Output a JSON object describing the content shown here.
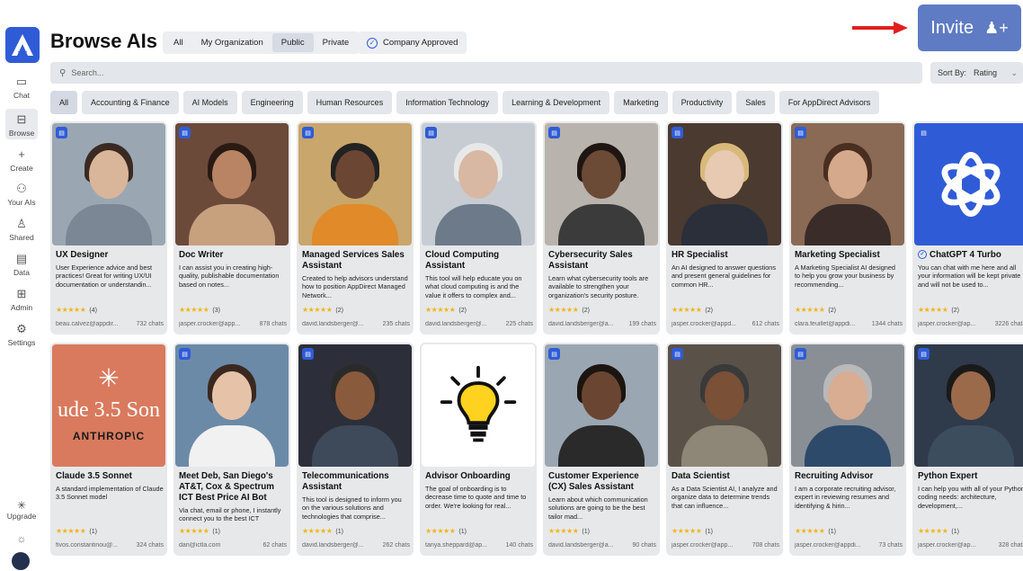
{
  "app": {
    "title": "Browse AIs"
  },
  "sidebar": {
    "items": [
      {
        "label": "Chat",
        "icon": "chat-icon"
      },
      {
        "label": "Browse",
        "icon": "browse-icon"
      },
      {
        "label": "Create",
        "icon": "plus-icon"
      },
      {
        "label": "Your AIs",
        "icon": "your-ais-icon"
      },
      {
        "label": "Shared",
        "icon": "shared-icon"
      },
      {
        "label": "Data",
        "icon": "data-icon"
      },
      {
        "label": "Admin",
        "icon": "admin-icon"
      },
      {
        "label": "Settings",
        "icon": "settings-icon"
      }
    ],
    "upgrade_label": "Upgrade"
  },
  "scope_tabs": [
    "All",
    "My Organization",
    "Public",
    "Private"
  ],
  "company_approved_label": "Company Approved",
  "invite_label": "Invite",
  "search": {
    "placeholder": "Search..."
  },
  "sort": {
    "label": "Sort By:",
    "value": "Rating"
  },
  "categories": [
    "All",
    "Accounting & Finance",
    "AI Models",
    "Engineering",
    "Human Resources",
    "Information Technology",
    "Learning & Development",
    "Marketing",
    "Productivity",
    "Sales",
    "For AppDirect Advisors"
  ],
  "cards": [
    {
      "name": "UX Designer",
      "desc": "User Experience advice and best practices! Great for writing UX/UI documentation or understandin...",
      "rating": "(4)",
      "author": "beau.calvez@appdir...",
      "chats": "732 chats"
    },
    {
      "name": "Doc Writer",
      "desc": "I can assist you in creating high-quality, publishable documentation based on notes...",
      "rating": "(3)",
      "author": "jasper.crocker@app...",
      "chats": "878 chats"
    },
    {
      "name": "Managed Services Sales Assistant",
      "desc": "Created to help advisors understand how to position AppDirect Managed Network...",
      "rating": "(2)",
      "author": "david.landsberger@...",
      "chats": "235 chats"
    },
    {
      "name": "Cloud Computing Assistant",
      "desc": "This tool will help educate you on what cloud computing is and the value it offers to complex and...",
      "rating": "(2)",
      "author": "david.landsberger@...",
      "chats": "225 chats"
    },
    {
      "name": "Cybersecurity Sales Assistant",
      "desc": "Learn what cybersecurity tools are available to strengthen your organization's security posture.",
      "rating": "(2)",
      "author": "david.landsberger@a...",
      "chats": "199 chats"
    },
    {
      "name": "HR Specialist",
      "desc": "An AI designed to answer questions and present general guidelines for common HR...",
      "rating": "(2)",
      "author": "jasper.crocker@appd...",
      "chats": "612 chats"
    },
    {
      "name": "Marketing Specialist",
      "desc": "A Marketing Specialist AI designed to help you grow your business by recommending...",
      "rating": "(2)",
      "author": "clara.feuillet@appdi...",
      "chats": "1344 chats"
    },
    {
      "name": "ChatGPT 4 Turbo",
      "desc": "You can chat with me here and all your information will be kept private and will not be used to...",
      "rating": "(2)",
      "author": "jasper.crocker@ap...",
      "chats": "3226 chats"
    },
    {
      "name": "Claude 3.5 Sonnet",
      "desc": "A standard implementation of Claude 3.5 Sonnet model",
      "rating": "(1)",
      "author": "fivos.constantinou@...",
      "chats": "324 chats",
      "img_text": "ude 3.5 Son",
      "img_brand": "ANTHROP\\C"
    },
    {
      "name": "Meet Deb, San Diego's AT&T, Cox & Spectrum ICT Best Price AI Bot",
      "desc": "Via chat, email or phone, I instantly connect you to the best ICT (\"information &...",
      "rating": "(1)",
      "author": "dan@ictla.com",
      "chats": "62 chats"
    },
    {
      "name": "Telecommunications Assistant",
      "desc": "This tool is designed to inform you on the various solutions and technologies that comprise...",
      "rating": "(1)",
      "author": "david.landsberger@...",
      "chats": "262 chats"
    },
    {
      "name": "Advisor Onboarding",
      "desc": "The goal of onboarding is to decrease time to quote and time to order. We're looking for real...",
      "rating": "(1)",
      "author": "tanya.sheppard@ap...",
      "chats": "140 chats"
    },
    {
      "name": "Customer Experience (CX) Sales Assistant",
      "desc": "Learn about which communication solutions are going to be the best tailor mad...",
      "rating": "(1)",
      "author": "david.landsberger@a...",
      "chats": "90 chats"
    },
    {
      "name": "Data Scientist",
      "desc": "As a Data Scientist AI, I analyze and organize data to determine trends that can influence...",
      "rating": "(1)",
      "author": "jasper.crocker@app...",
      "chats": "708 chats"
    },
    {
      "name": "Recruiting Advisor",
      "desc": "I am a corporate recruiting advisor, expert in reviewing resumes and identifying & hirin...",
      "rating": "(1)",
      "author": "jasper.crocker@appdi...",
      "chats": "73 chats"
    },
    {
      "name": "Python Expert",
      "desc": "I can help you with all of your Python coding needs: architecture, development,...",
      "rating": "(1)",
      "author": "jasper.crocker@ap...",
      "chats": "328 chats"
    }
  ],
  "colors": {
    "accent": "#2f5cd6",
    "invite_bg": "#5e7bc3",
    "star": "#f2b51a",
    "card_bg": "#e7e8ea"
  }
}
